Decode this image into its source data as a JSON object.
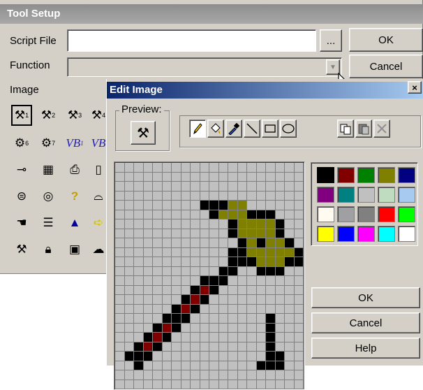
{
  "tool_setup": {
    "title": "Tool Setup",
    "script_file_label": "Script File",
    "script_file_value": "",
    "browse_label": "...",
    "function_label": "Function",
    "function_value": "",
    "image_label": "Image",
    "ok_label": "OK",
    "cancel_label": "Cancel",
    "icons": [
      [
        "hammer-1-icon",
        "hammer-2-icon",
        "hammer-3-icon",
        "hammer-4-icon"
      ],
      [
        "gear-6-icon",
        "gear-7-icon",
        "vb-1-icon",
        "vb-2-icon"
      ],
      [
        "key-icon",
        "calculator-icon",
        "scanner-icon",
        "blank-page-icon"
      ],
      [
        "disk-drive-icon",
        "cd-icon",
        "help-icon",
        "shape-icon"
      ],
      [
        "hand-icon",
        "list-sort-icon",
        "pen-tool-icon",
        "arrow-right-icon"
      ],
      [
        "tools-icon",
        "lock-icon",
        "film-icon",
        "cloud-icon"
      ]
    ],
    "vb_text": "VB",
    "sub_numbers": [
      "1",
      "2",
      "3",
      "4",
      "6",
      "7",
      "1"
    ]
  },
  "edit_image": {
    "title": "Edit Image",
    "close_label": "×",
    "preview_label": "Preview:",
    "tools": [
      "pencil-icon",
      "fill-bucket-icon",
      "eyedropper-icon",
      "line-icon",
      "rectangle-icon",
      "ellipse-icon",
      "copy-icon",
      "paste-icon",
      "clear-icon"
    ],
    "palette": [
      "#000000",
      "#800000",
      "#008000",
      "#808000",
      "#000080",
      "#800080",
      "#008080",
      "#c0c0c0",
      "#c0dcc0",
      "#a6caf0",
      "#fffbf0",
      "#a0a0a4",
      "#808080",
      "#ff0000",
      "#00ff00",
      "#ffff00",
      "#0000ff",
      "#ff00ff",
      "#00ffff",
      "#ffffff"
    ],
    "selected_color_index": 0,
    "ok_label": "OK",
    "cancel_label": "Cancel",
    "help_label": "Help",
    "pixel_colors": {
      "0": "#c0c0c0",
      "1": "#000000",
      "2": "#808000",
      "3": "#800000"
    },
    "pixels": [
      "00000000000000000000",
      "00000000000000000000",
      "00000000000000000000",
      "00000000000000000000",
      "00000000011122000000",
      "00000000001222111000",
      "00000000000012222100",
      "00000000000012222100",
      "00000000000001212210",
      "00000000000011222221",
      "00000000000011122211",
      "00000000000110011100",
      "00000000011100000000",
      "00000000131000000000",
      "00000001310000000000",
      "00000013100000000000",
      "00000111000000001000",
      "00001310000000001000",
      "00013100000000001000",
      "00131000000000001000",
      "01110000000000001100",
      "00100000000000011100",
      "00000000000000000000",
      "00000000000000000000"
    ]
  }
}
